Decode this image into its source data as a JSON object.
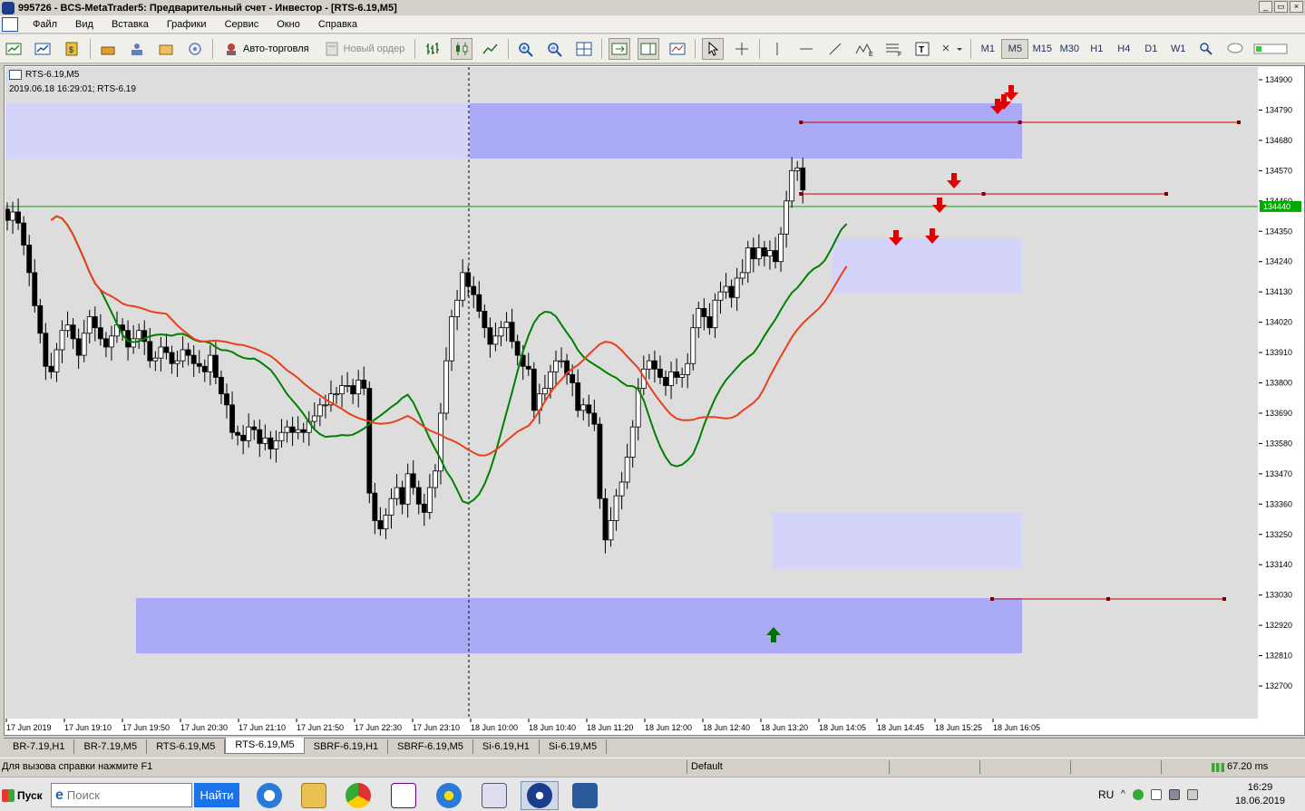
{
  "window": {
    "title": "995726 - BCS-MetaTrader5: Предварительный счет - Инвестор - [RTS-6.19,M5]",
    "controls": [
      "_",
      "▭",
      "×"
    ]
  },
  "menu": [
    "Файл",
    "Вид",
    "Вставка",
    "Графики",
    "Сервис",
    "Окно",
    "Справка"
  ],
  "toolbar": {
    "autotrading_label": "Авто-торговля",
    "new_order_label": "Новый ордер",
    "timeframes": [
      "M1",
      "M5",
      "M15",
      "M30",
      "H1",
      "H4",
      "D1",
      "W1"
    ],
    "active_timeframe": "M5"
  },
  "chart": {
    "symbol_label": "RTS-6.19,M5",
    "info_line": "2019.06.18 16:29:01; RTS-6.19",
    "current_price_label": "134440",
    "price_axis": [
      "134900",
      "134790",
      "134680",
      "134570",
      "134460",
      "134350",
      "134240",
      "134130",
      "134020",
      "133910",
      "133800",
      "133690",
      "133580",
      "133470",
      "133360",
      "133250",
      "133140",
      "133030",
      "132920",
      "132810",
      "132700"
    ],
    "time_axis": [
      "17 Jun 2019",
      "17 Jun 19:10",
      "17 Jun 19:50",
      "17 Jun 20:30",
      "17 Jun 21:10",
      "17 Jun 21:50",
      "17 Jun 22:30",
      "17 Jun 23:10",
      "18 Jun 10:00",
      "18 Jun 10:40",
      "18 Jun 11:20",
      "18 Jun 12:00",
      "18 Jun 12:40",
      "18 Jun 13:20",
      "18 Jun 14:05",
      "18 Jun 14:45",
      "18 Jun 15:25",
      "18 Jun 16:05"
    ],
    "colors": {
      "background": "#dddddd",
      "bull_candle": "#ffffff",
      "bear_candle": "#000000",
      "fast_ma": "#008000",
      "slow_ma": "#e8401a",
      "zone_dark": "#aaaaf6",
      "zone_light": "#d4d4fa",
      "signal_down": "#e00000",
      "signal_up": "#007000",
      "level_line": "#cc0000",
      "price_line": "#00aa00"
    }
  },
  "tabs": [
    "BR-7.19,H1",
    "BR-7.19,M5",
    "RTS-6.19,M5",
    "RTS-6.19,M5",
    "SBRF-6.19,H1",
    "SBRF-6.19,M5",
    "Si-6.19,H1",
    "Si-6.19,M5"
  ],
  "active_tab_index": 3,
  "status": {
    "help": "Для вызова справки нажмите F1",
    "profile": "Default",
    "ping": "67.20 ms"
  },
  "taskbar": {
    "start": "Пуск",
    "search_placeholder": "Поиск",
    "find_button": "Найти",
    "lang": "RU",
    "time": "16:29",
    "date": "18.06.2019"
  }
}
